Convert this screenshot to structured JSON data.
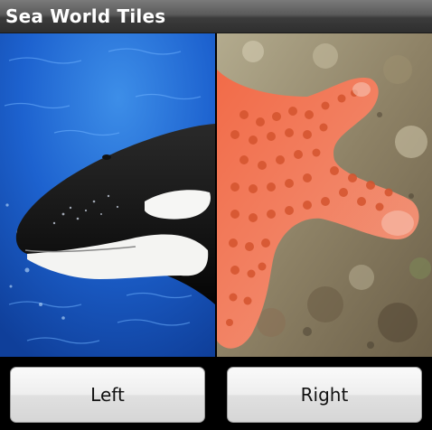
{
  "app": {
    "title": "Sea World Tiles"
  },
  "tiles": {
    "left": {
      "subject": "orca"
    },
    "right": {
      "subject": "starfish"
    }
  },
  "buttons": {
    "left_label": "Left",
    "right_label": "Right"
  },
  "colors": {
    "titlebar": "#4a4a4a",
    "water": "#1e5fc8",
    "starfish": "#f07a52",
    "button_face": "#eeeeee"
  }
}
